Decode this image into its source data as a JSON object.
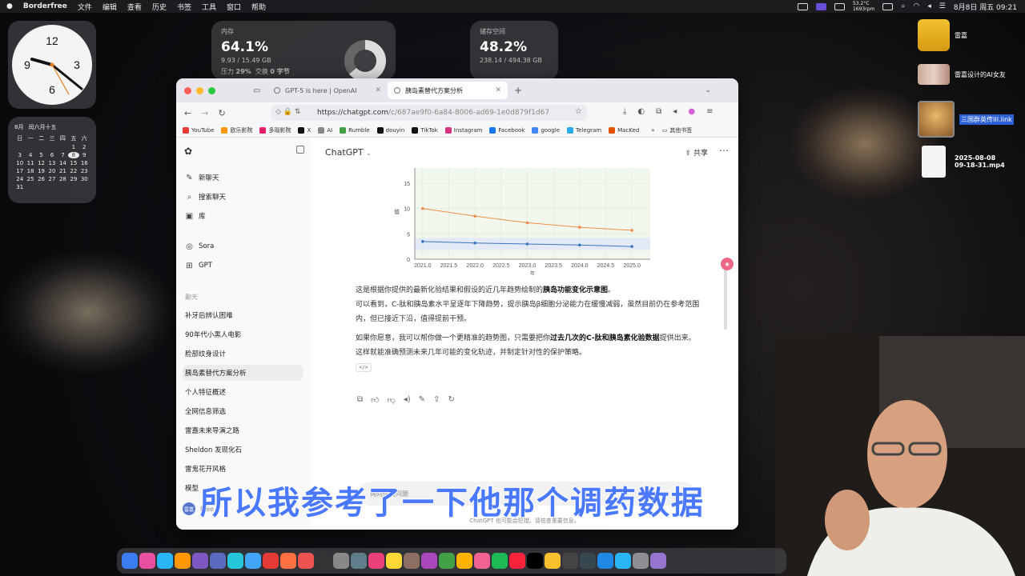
{
  "menubar": {
    "app": "Borderfree",
    "items": [
      "文件",
      "编辑",
      "查看",
      "历史",
      "书签",
      "工具",
      "窗口",
      "帮助"
    ],
    "temp": "53.2°C",
    "rpm": "1693rpm",
    "datetime": "8月8日 周五  09:21"
  },
  "widgets": {
    "clock": {
      "numbers": [
        "12",
        "3",
        "6",
        "9"
      ]
    },
    "calendar": {
      "month": "8月",
      "lunar": "闰六月十五",
      "weekdays": [
        "日",
        "一",
        "二",
        "三",
        "四",
        "五",
        "六"
      ],
      "days": [
        "",
        "",
        "",
        "",
        "",
        "1",
        "2",
        "3",
        "4",
        "5",
        "6",
        "7",
        "8",
        "9",
        "10",
        "11",
        "12",
        "13",
        "14",
        "15",
        "16",
        "17",
        "18",
        "19",
        "20",
        "21",
        "22",
        "23",
        "24",
        "25",
        "26",
        "27",
        "28",
        "29",
        "30",
        "31"
      ],
      "today": "8"
    },
    "memory": {
      "label": "内存",
      "percent": "64.1%",
      "detail": "9.93 / 15.49 GB",
      "pressure_label": "压力",
      "pressure": "29%",
      "swap_label": "交换",
      "swap": "0 字节",
      "used_fraction": 0.641
    },
    "storage": {
      "label": "储存空间",
      "percent": "48.2%",
      "detail": "238.14 / 494.38 GB"
    }
  },
  "desktop_files": [
    {
      "name": "雷嘉"
    },
    {
      "name": "雷嘉设计的AI女友"
    },
    {
      "name": "三国群英传III.link"
    },
    {
      "name": "2025-08-08\n09-18-31.mp4"
    }
  ],
  "browser": {
    "tabs": [
      {
        "title": "GPT-5 is here | OpenAI"
      },
      {
        "title": "胰岛素替代方案分析"
      }
    ],
    "url_host": "https://chatgpt.com",
    "url_path": "/c/687ae9f0-6a84-8006-ad69-1e0d879f1d67",
    "bookmarks": [
      "YouTube",
      "欧乐影院",
      "多瑙影院",
      "X",
      "AI",
      "Rumble",
      "douyin",
      "TikTok",
      "Instagram",
      "Facebook",
      "google",
      "Telegram",
      "MacKed"
    ],
    "other_bookmarks": "其他书签"
  },
  "sidebar": {
    "top_items": [
      {
        "label": "新聊天",
        "icon": "edit-icon"
      },
      {
        "label": "搜索聊天",
        "icon": "search-icon"
      },
      {
        "label": "库",
        "icon": "library-icon"
      }
    ],
    "apps": [
      {
        "label": "Sora",
        "icon": "sora-icon"
      },
      {
        "label": "GPT",
        "icon": "grid-icon"
      }
    ],
    "section": "聊天",
    "chats": [
      "补牙后辨认困难",
      "90年代小黑人电影",
      "脸部纹身设计",
      "胰岛素替代方案分析",
      "个人特征概述",
      "全网信息筛选",
      "雷嘉未来导演之路",
      "Sheldon 发现化石",
      "雷鬼花开风格",
      "模型"
    ],
    "selected_chat": "胰岛素替代方案分析",
    "plan": "Free",
    "avatar_initials": "雷嘉"
  },
  "chat": {
    "model": "ChatGPT",
    "share": "共享",
    "para1_a": "这是根据你提供的最新化验结果和假设的近几年趋势绘制的",
    "para1_b": "胰岛功能变化示意图",
    "para1_c": "。",
    "para2": "可以看到，C-肽和胰岛素水平呈逐年下降趋势，提示胰岛β细胞分泌能力在缓慢减弱，虽然目前仍在参考范围内，但已接近下沿，值得提前干预。",
    "para3_a": "如果你愿意，我可以帮你做一个更精准的趋势图，只需要把你",
    "para3_b": "过去几次的C-肽和胰岛素化验数据",
    "para3_c": "提供出来。这样就能准确预测未来几年可能的变化轨迹，并制定针对性的保护策略。",
    "code_badge": "</>",
    "input_placeholder": "询问任何问题",
    "footnote": "ChatGPT 也可能会犯错。请核查重要信息。"
  },
  "chart_data": {
    "type": "line",
    "x": [
      2021.0,
      2022.0,
      2023.0,
      2024.0,
      2025.0
    ],
    "x_ticks": [
      "2021.0",
      "2021.5",
      "2022.0",
      "2022.5",
      "2023.0",
      "2023.5",
      "2024.0",
      "2024.5",
      "2025.0"
    ],
    "y_ticks": [
      "0",
      "5",
      "10",
      "15"
    ],
    "ylim": [
      0,
      18
    ],
    "xlim": [
      2020.85,
      2025.35
    ],
    "ylabel": "值",
    "xlabel": "年",
    "grid": true,
    "series": [
      {
        "color": "#f08c4a",
        "values": [
          10.0,
          8.5,
          7.2,
          6.3,
          5.7
        ]
      },
      {
        "color": "#3a78c0",
        "values": [
          3.5,
          3.2,
          3.0,
          2.8,
          2.5
        ]
      }
    ],
    "reference_band": [
      1.8,
      4.2
    ]
  },
  "subtitle": "所以我参考了一下他那个调药数据",
  "dock_colors": [
    "#3b7df0",
    "#e84fa0",
    "#29b6f6",
    "#ff9800",
    "#7e57c2",
    "#5c6bc0",
    "#26c6da",
    "#42a5f5",
    "#e53935",
    "#ff7043",
    "#ef5350",
    "#333333",
    "#888888",
    "#607d8b",
    "#ec407a",
    "#fdd835",
    "#8d6e63",
    "#ab47bc",
    "#43a047",
    "#ffb300",
    "#f06292",
    "#1db954",
    "#fa233b",
    "#000000",
    "#fbc02d",
    "#444444",
    "#37474f",
    "#1e88e5",
    "#29b6f6",
    "#8e8e93",
    "#9575cd"
  ]
}
